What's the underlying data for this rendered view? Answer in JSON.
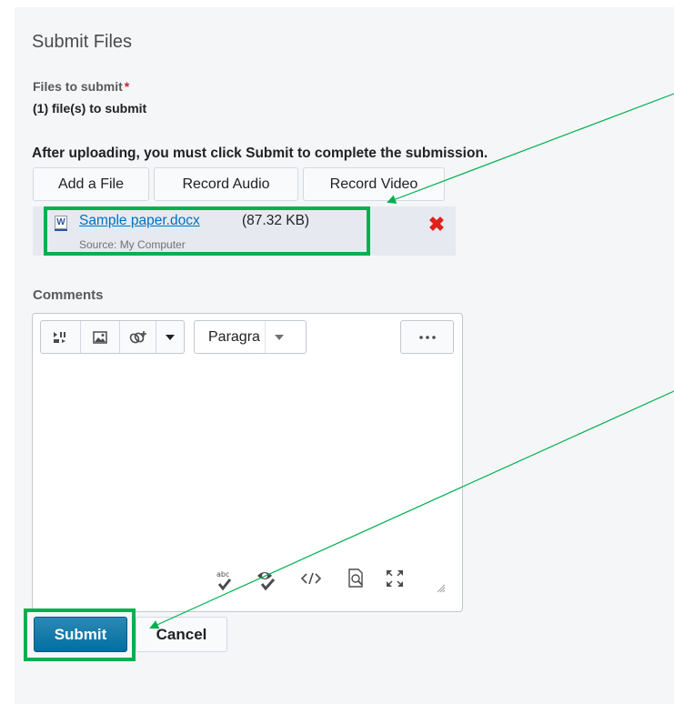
{
  "page": {
    "title": "Submit Files"
  },
  "files": {
    "label": "Files to submit",
    "required_marker": "*",
    "count_text": "(1) file(s) to submit",
    "instruction": "After uploading, you must click Submit to complete the submission.",
    "buttons": {
      "add_file": "Add a File",
      "record_audio": "Record Audio",
      "record_video": "Record Video"
    },
    "items": [
      {
        "name": "Sample paper.docx",
        "size": "(87.32 KB)",
        "source": "Source: My Computer",
        "icon": "word-doc-icon",
        "icon_letter": "W"
      }
    ]
  },
  "comments": {
    "label": "Comments",
    "toolbar": {
      "format_select": "Paragra"
    }
  },
  "actions": {
    "submit": "Submit",
    "cancel": "Cancel"
  },
  "colors": {
    "highlight": "#00b050",
    "primary": "#006fa3",
    "link": "#006fbf",
    "remove": "#e0201b"
  }
}
